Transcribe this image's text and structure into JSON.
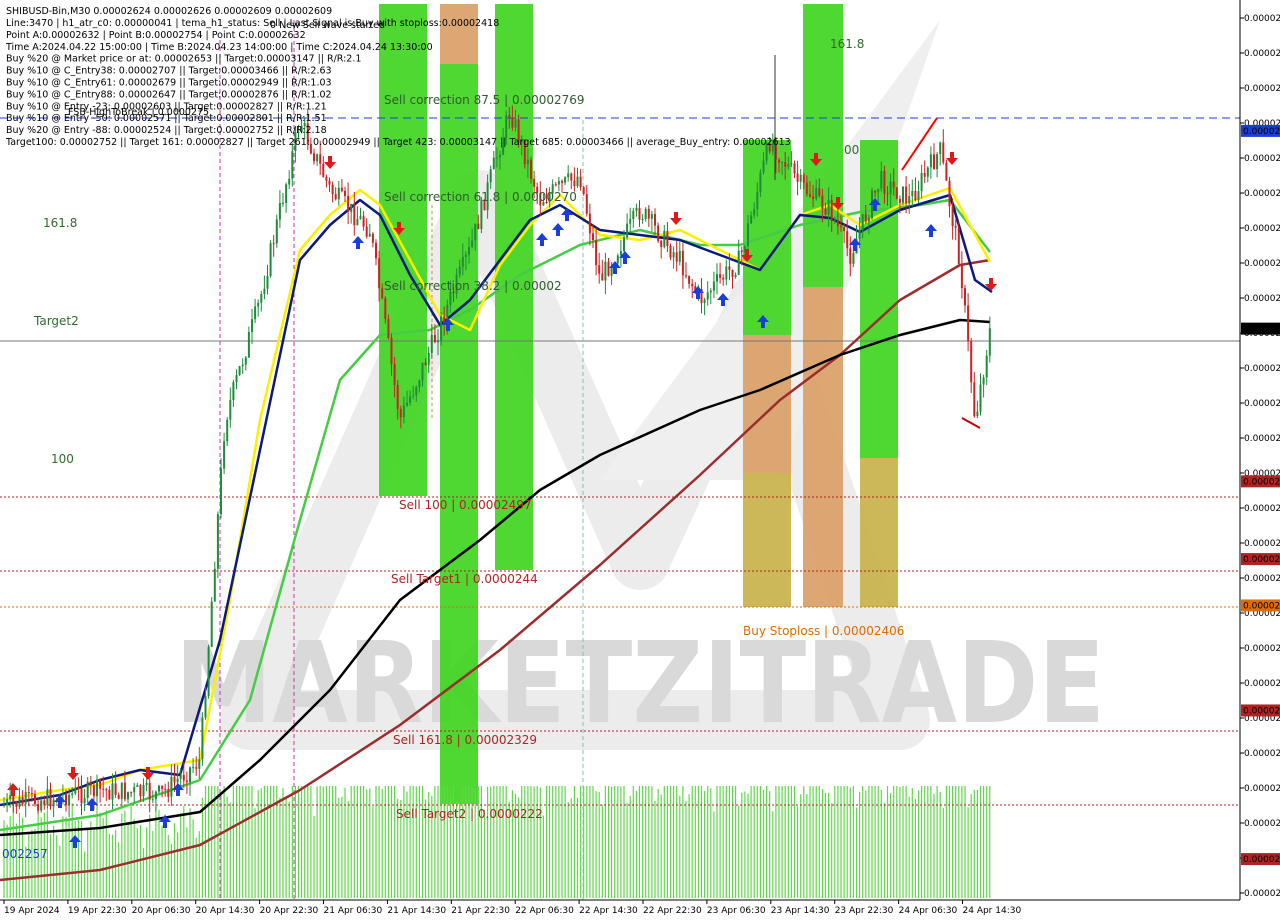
{
  "chart_data": {
    "type": "candlestick",
    "symbol_header": "SHIBUSD-Bin,M30  0.00002624 0.00002626 0.00002609 0.00002609",
    "info_lines": [
      "Line:3470 | h1_atr_c0: 0.00000041 | tema_h1_status: Sell | Last Signal is:Buy with stoploss:0.00002418",
      "Point A:0.00002632 | Point B:0.00002754 | Point C:0.00002632",
      "Time A:2024.04.22 15:00:00 | Time B:2024.04.23 14:00:00 | Time C:2024.04.24 13:30:00",
      "Buy %20 @ Market price or at: 0.00002653 || Target:0.00003147 || R/R:2.1",
      "Buy %10 @ C_Entry38: 0.00002707 || Target:0.00003466 || R/R:2.63",
      "Buy %10 @ C_Entry61: 0.00002679 || Target:0.00002949 || R/R:1.03",
      "Buy %10 @ C_Entry88: 0.00002647 || Target:0.00002876 || R/R:1.02",
      "Buy %10 @ Entry -23: 0.00002603 || Target:0.00002827 || R/R:1.21",
      "Buy %10 @ Entry -50: 0.00002571 || Target:0.00002801 || R/R:1.51",
      "Buy %20 @ Entry -88: 0.00002524 || Target:0.00002752 || R/R:2.18",
      "Target100: 0.00002752 || Target 161: 0.00002827 || Target 261: 0.00002949 || Target 423: 0.00003147 || Target 685: 0.00003466 || average_Buy_entry: 0.00002613"
    ],
    "new_wave_label": "0 New Sell wave started",
    "fsb_label": "FSB-HighToBreak | 0.0000275",
    "time_labels": [
      "19 Apr 2024",
      "19 Apr 22:30",
      "20 Apr 06:30",
      "20 Apr 14:30",
      "20 Apr 22:30",
      "21 Apr 06:30",
      "21 Apr 14:30",
      "21 Apr 22:30",
      "22 Apr 06:30",
      "22 Apr 14:30",
      "22 Apr 22:30",
      "23 Apr 06:30",
      "23 Apr 14:30",
      "23 Apr 22:30",
      "24 Apr 06:30",
      "24 Apr 14:30"
    ],
    "price_ticks": [
      "0.00002",
      "0.00002",
      "0.00002",
      "0.00002",
      "0.00002",
      "0.00002",
      "0.00002",
      "0.00002",
      "0.00002",
      "0.00002",
      "0.00002",
      "0.00002",
      "0.00002",
      "0.00002",
      "0.00002",
      "0.00002",
      "0.00002",
      "0.00002",
      "0.00002",
      "0.00002",
      "0.00002",
      "0.00002",
      "0.00002",
      "0.00002",
      "0.00002",
      "0.00002"
    ],
    "price_badges": [
      {
        "label": "0.00002",
        "color": "#1a3fd6",
        "y_value": 2.754e-05
      },
      {
        "label": "0.00002",
        "color": "#000000",
        "y_value": 2.609e-05
      },
      {
        "label": "0.00002",
        "color": "#b22222",
        "y_value": 2.497e-05
      },
      {
        "label": "0.00002",
        "color": "#b22222",
        "y_value": 2.44e-05
      },
      {
        "label": "0.00002",
        "color": "#e06c00",
        "y_value": 2.406e-05
      },
      {
        "label": "0.00002",
        "color": "#b22222",
        "y_value": 2.329e-05
      },
      {
        "label": "0.00002",
        "color": "#b22222",
        "y_value": 2.22e-05
      }
    ],
    "level_labels": [
      {
        "text": "Sell correction 87.5 | 0.00002769",
        "color": "#2f5c2f"
      },
      {
        "text": "Sell correction 61.8 | 0.0000270",
        "color": "#2f5c2f"
      },
      {
        "text": "Sell correction 38.2 | 0.00002",
        "color": "#2f5c2f"
      },
      {
        "text": "Sell 100 | 0.00002497",
        "color": "#b22222"
      },
      {
        "text": "Sell Target1 | 0.0000244",
        "color": "#b22222"
      },
      {
        "text": "Buy Stoploss | 0.00002406",
        "color": "#e06c00"
      },
      {
        "text": "Sell 161.8 | 0.00002329",
        "color": "#b22222"
      },
      {
        "text": "Sell Target2 | 0.0000222",
        "color": "#b22222"
      }
    ],
    "left_labels": [
      "161.8",
      "Target2",
      "100"
    ],
    "top_right_label": "161.8",
    "partial_label": "00",
    "bottom_left_price": "002257",
    "watermark": "MARKETZITRADE",
    "y_range": [
      2.19e-05,
      2.85e-05
    ],
    "colors": {
      "bull": "#1e8c3a",
      "bear": "#cc2222",
      "ema_yellow": "#ffee00",
      "ema_navy": "#0a1a7a",
      "ema_green": "#44cc44",
      "ema_black": "#000000",
      "ema_brown": "#9b2d2d",
      "zone_green": "#3fd51f",
      "zone_orange": "#d9a066",
      "zone_olive": "#c8b24a"
    }
  }
}
